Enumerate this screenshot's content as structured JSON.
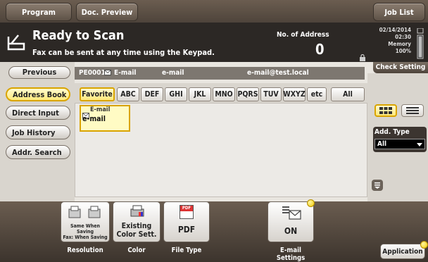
{
  "top_tabs": {
    "program": "Program",
    "doc_preview": "Doc. Preview",
    "job_list": "Job List"
  },
  "status": {
    "title": "Ready to Scan",
    "message": "Fax can be sent at any time using the Keypad.",
    "no_of_address_label": "No. of Address",
    "no_of_address_value": "0",
    "date": "02/14/2014",
    "time": "02:30",
    "memory_label": "Memory",
    "memory_value": "100%"
  },
  "previous_label": "Previous",
  "destination": {
    "id": "PE0001",
    "type": "E-mail",
    "name": "e-mail",
    "address": "e-mail@test.local"
  },
  "check_setting_label": "Check Setting",
  "sidebar": {
    "items": [
      {
        "label": "Address Book",
        "active": true
      },
      {
        "label": "Direct Input",
        "active": false
      },
      {
        "label": "Job History",
        "active": false
      },
      {
        "label": "Addr. Search",
        "active": false
      }
    ]
  },
  "index_tabs": [
    "Favorite",
    "ABC",
    "DEF",
    "GHI",
    "JKL",
    "MNO",
    "PQRS",
    "TUV",
    "WXYZ",
    "etc",
    "All"
  ],
  "active_index": "Favorite",
  "entries": [
    {
      "type": "E-mail",
      "name": "e-mail"
    }
  ],
  "add_type": {
    "label": "Add. Type",
    "value": "All"
  },
  "function_keys": [
    {
      "button_text": "",
      "line1": "Same When Saving",
      "line2": "Fax: When Saving",
      "caption": "Resolution"
    },
    {
      "button_text": "Existing Color Sett.",
      "caption": "Color"
    },
    {
      "button_text": "PDF",
      "icon_text": "PDF",
      "caption": "File Type"
    },
    {
      "button_text": "ON",
      "caption_line1": "E-mail",
      "caption_line2": "Settings"
    }
  ],
  "application_label": "Application",
  "colors": {
    "accent_yellow": "#ffe97a",
    "selected_border": "#d9a400",
    "header_dark": "#2c2825",
    "frame_brown": "#4e443b"
  }
}
